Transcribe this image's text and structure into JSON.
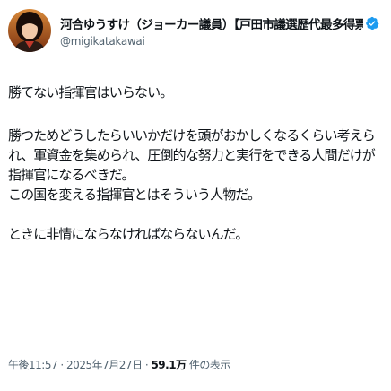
{
  "header": {
    "display_name": "河合ゆうすけ（ジョーカー議員）【戸田市議選歴代最多得票トップ...",
    "handle": "@migikatakawai",
    "verified_color": "#1d9bf0"
  },
  "tweet": {
    "line1": "勝てない指揮官はいらない。",
    "line2": "勝つためどうしたらいいかだけを頭がおかしくなるくらい考えられ、軍資金を集められ、圧倒的な努力と実行をできる人間だけが指揮官になるべきだ。",
    "line3": "この国を変える指揮官とはそういう人物だ。",
    "line4": "ときに非情にならなければならないんだ。"
  },
  "meta": {
    "time": "午後11:57",
    "sep1": " · ",
    "date": "2025年7月27日",
    "sep2": " · ",
    "views": "59.1万",
    "views_label": " 件の表示"
  },
  "colors": {
    "text": "#0f1419",
    "secondary": "#536471",
    "background": "#ffffff"
  },
  "icons": {
    "verified": "verified-badge-icon",
    "avatar": "avatar"
  }
}
